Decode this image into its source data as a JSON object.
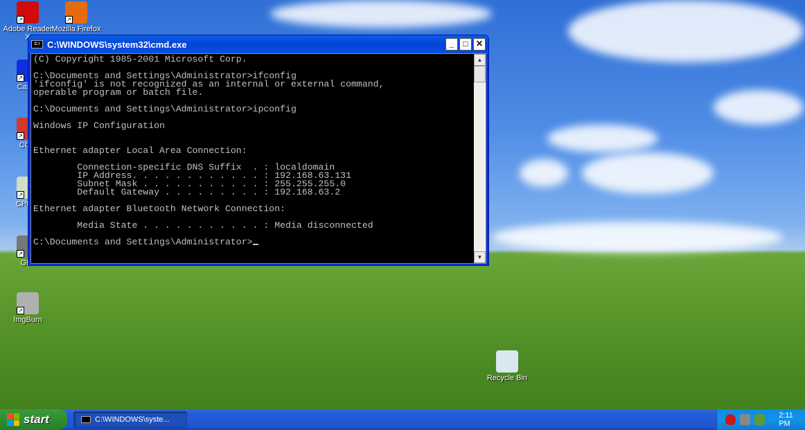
{
  "desktop": {
    "icons": [
      {
        "label": "Adobe Reader X",
        "color": "#d10a0a"
      },
      {
        "label": "Mozilla Firefox",
        "color": "#e66a10"
      },
      {
        "label": "CamS",
        "color": "#1030e0"
      },
      {
        "label": "CCle",
        "color": "#d03a2a"
      },
      {
        "label": "CPUID",
        "color": "#cfe0c0"
      },
      {
        "label": "GIM",
        "color": "#777777"
      },
      {
        "label": "ImgBurn",
        "color": "#b0b0b0"
      },
      {
        "label": "Recycle Bin",
        "color": "#d8e8f0"
      }
    ]
  },
  "window": {
    "title": "C:\\WINDOWS\\system32\\cmd.exe",
    "icon_label": "C:\\",
    "console_lines": [
      "(C) Copyright 1985-2001 Microsoft Corp.",
      "",
      "C:\\Documents and Settings\\Administrator>ifconfig",
      "'ifconfig' is not recognized as an internal or external command,",
      "operable program or batch file.",
      "",
      "C:\\Documents and Settings\\Administrator>ipconfig",
      "",
      "Windows IP Configuration",
      "",
      "",
      "Ethernet adapter Local Area Connection:",
      "",
      "        Connection-specific DNS Suffix  . : localdomain",
      "        IP Address. . . . . . . . . . . . : 192.168.63.131",
      "        Subnet Mask . . . . . . . . . . . : 255.255.255.0",
      "        Default Gateway . . . . . . . . . : 192.168.63.2",
      "",
      "Ethernet adapter Bluetooth Network Connection:",
      "",
      "        Media State . . . . . . . . . . . : Media disconnected",
      "",
      "C:\\Documents and Settings\\Administrator>"
    ],
    "minimize": "_",
    "maximize": "□",
    "close": "✕"
  },
  "taskbar": {
    "start_label": "start",
    "task_label": "C:\\WINDOWS\\syste...",
    "clock": "2:11 PM",
    "tray_icons": [
      "security-alert-icon",
      "vmware-icon",
      "network-icon"
    ]
  }
}
